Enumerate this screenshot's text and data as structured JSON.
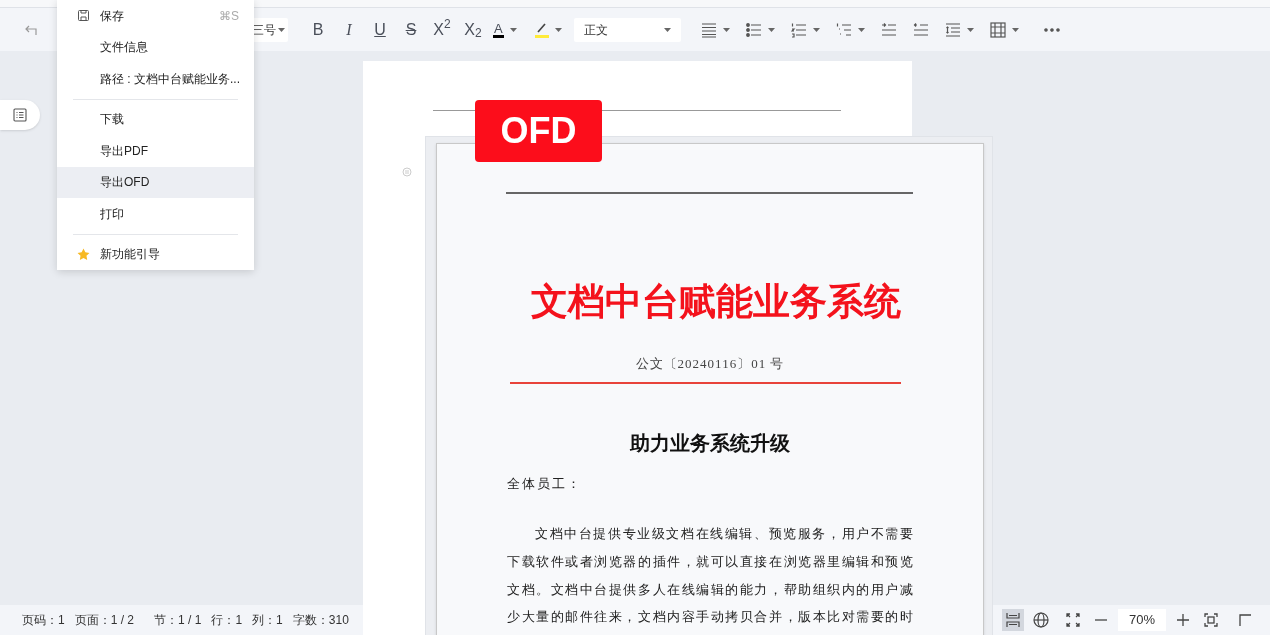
{
  "toolbar": [
    {
      "kind": "undo"
    },
    {
      "kind": "font-size",
      "label": "三号"
    },
    {
      "kind": "bold",
      "label": "B"
    },
    {
      "kind": "italic",
      "label": "I"
    },
    {
      "kind": "underline",
      "label": "U"
    },
    {
      "kind": "strike",
      "label": "S"
    },
    {
      "kind": "sup",
      "label": "X$^{2}$"
    },
    {
      "kind": "sub",
      "label": "X$_{2}$"
    },
    {
      "kind": "font-color",
      "label": "A",
      "color": "#000000"
    },
    {
      "kind": "highlight",
      "color": "#ffeb3b"
    },
    {
      "kind": "style",
      "label": "正文"
    },
    {
      "kind": "align"
    },
    {
      "kind": "bullets"
    },
    {
      "kind": "numbered"
    },
    {
      "kind": "multilevel"
    },
    {
      "kind": "indent"
    },
    {
      "kind": "outdent"
    },
    {
      "kind": "spacing"
    },
    {
      "kind": "table"
    },
    {
      "kind": "more"
    }
  ],
  "file_menu": [
    {
      "kind": "save",
      "label": "保存",
      "shortcut": "⌘S",
      "selected": false
    },
    {
      "kind": "item",
      "label": "文件信息",
      "selected": false
    },
    {
      "kind": "item",
      "label": "路径 : 文档中台赋能业务...",
      "selected": false
    },
    {
      "kind": "divider"
    },
    {
      "kind": "item",
      "label": "下载",
      "selected": false
    },
    {
      "kind": "item",
      "label": "导出PDF",
      "selected": false
    },
    {
      "kind": "item",
      "label": "导出OFD",
      "selected": true
    },
    {
      "kind": "item",
      "label": "打印",
      "selected": false
    },
    {
      "kind": "divider"
    },
    {
      "kind": "guide",
      "label": "新功能引导",
      "selected": false
    }
  ],
  "ofd_badge": "OFD",
  "document": {
    "title": "文档中台赋能业务系统",
    "doc_number": "公文〔20240116〕01 号",
    "heading": "助力业务系统升级",
    "salutation": "全体员工：",
    "paragraph_lines": [
      "文档中台提供专业级文档在线编辑、预览服务，用户不需要",
      "下载软件或者浏览器的插件，就可以直接在浏览器里编辑和预览",
      "文档。文档中台提供多人在线编辑的能力，帮助组织内的用户减",
      "少大量的邮件往来，文档内容手动拷贝合并，版本比对需要的时"
    ]
  },
  "status_bar": {
    "fields": [
      "页码：1",
      "页面：1 / 2",
      "节：1 / 1",
      "行：1",
      "列：1",
      "字数：310"
    ],
    "views": [
      {
        "kind": "print-layout",
        "selected": true
      },
      {
        "kind": "web-layout",
        "selected": false
      }
    ],
    "zoom": "70%"
  }
}
